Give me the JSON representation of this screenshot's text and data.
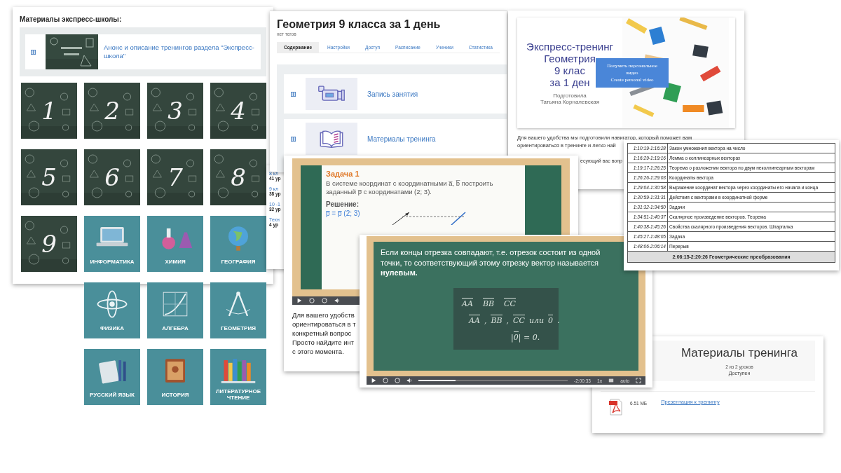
{
  "school_panel": {
    "title": "Материалы экспресс-школы:",
    "announce": {
      "link": "Анонс и описание тренингов раздела \"Экспресс-школа\""
    },
    "number_tiles": [
      "1",
      "2",
      "3",
      "4",
      "5",
      "6",
      "7",
      "8",
      "9"
    ],
    "subject_tiles": [
      "ИНФОРМАТИКА",
      "ХИМИЯ",
      "ГЕОГРАФИЯ",
      "ФИЗИКА",
      "АЛГЕБРА",
      "ГЕОМЕТРИЯ",
      "РУССКИЙ ЯЗЫК",
      "ИСТОРИЯ",
      "ЛИТЕРАТУРНОЕ ЧТЕНИЕ"
    ]
  },
  "course_panel": {
    "title": "Геометрия 9 класса за 1 день",
    "tags": "нет тегов",
    "tabs": [
      {
        "label": "Содержание",
        "selected": true
      },
      {
        "label": "Настройки",
        "selected": false
      },
      {
        "label": "Доступ",
        "selected": false
      },
      {
        "label": "Расписание",
        "selected": false
      },
      {
        "label": "Ученики",
        "selected": false
      },
      {
        "label": "Статистика",
        "selected": false
      }
    ],
    "lessons": [
      {
        "kind": "video",
        "title": "Запись занятия"
      },
      {
        "kind": "book",
        "title": "Материалы тренинга"
      }
    ]
  },
  "hidden_list": [
    {
      "name": "8 кл",
      "count": "41 ур"
    },
    {
      "name": "9 кл",
      "count": "38 ур"
    },
    {
      "name": "10 -1",
      "count": "32 ур"
    },
    {
      "name": "Техн",
      "count": "4 ур"
    }
  ],
  "slide_panel": {
    "slide_lines": [
      "Экспресс-тренинг",
      "Геометрия",
      "9 клас",
      "за 1 ден"
    ],
    "author_lines": [
      "Подготовила",
      "Татьяна Корналевская"
    ],
    "overlay_button": [
      "Получить персональное",
      "видео",
      "Create personal video"
    ],
    "text_lines": [
      "Для вашего удобства мы подготовили навигатор, который поможет вам",
      "ориентироваться в тренинге и легко най",
      "есующий вас вопр"
    ]
  },
  "navigator_table": {
    "rows": [
      {
        "time": "1:10:19-1:16:28",
        "topic": "Закон умножения вектора на число"
      },
      {
        "time": "1:16:29-1:19:16",
        "topic": "Лемма о коллинеарных векторах"
      },
      {
        "time": "1:19:17-1:26:25",
        "topic": "Теорема о разложении вектора по двум неколлинеарным векторам"
      },
      {
        "time": "1:26:26-1:29:03",
        "topic": "Координаты вектора"
      },
      {
        "time": "1:29:04-1:30:58",
        "topic": "Выражение координат вектора через координаты его начала и конца"
      },
      {
        "time": "1:30:59-1:31:31",
        "topic": "Действия с векторами в координатной форме"
      },
      {
        "time": "1:31:32-1:34:50",
        "topic": "Задачи"
      },
      {
        "time": "1:34:51-1:40:37",
        "topic": "Скалярное произведение векторов. Теорема"
      },
      {
        "time": "1:40:38-1:45:26",
        "topic": "Свойства скалярного произведения векторов. Шпаргалка"
      },
      {
        "time": "1:45:27-1:48:05",
        "topic": "Задача"
      },
      {
        "time": "1:48:06-2:06:14",
        "topic": "Перерыв"
      }
    ],
    "footer": "2:06:15-2:20:26 Геометрические преобразования"
  },
  "video_task": {
    "heading": "Задача 1",
    "statement": "В системе координат с координатными a̅, b̅ построить заданный p̅ с координатами (2; 3).",
    "solution_label": "Решение:",
    "solution_lines": [
      "p̅ = p̅ (2; 3)"
    ],
    "text_lines": [
      "Для вашего удобств",
      "ориентироваться в т",
      "конкретный вопрос",
      "Просто найдите инт",
      "с этого момента."
    ]
  },
  "video_vector": {
    "statement": "Если концы отрезка совпадают, т.е. отрезок состоит из одной точки, то соответствующий этому отрезку вектор называется **нулевым.**",
    "formula_rows": [
      [
        {
          "text": "AA",
          "vector": true
        },
        {
          "text": "BB",
          "vector": true
        },
        {
          "text": "CC",
          "vector": true
        }
      ],
      [
        {
          "text": "AA",
          "vector": true
        },
        {
          "text": ",",
          "vector": false
        },
        {
          "text": "BB",
          "vector": true
        },
        {
          "text": ",",
          "vector": false
        },
        {
          "text": "CC",
          "vector": true
        },
        {
          "text": "или",
          "vector": false
        },
        {
          "text": "0",
          "vector": true
        },
        {
          "text": ".",
          "vector": false
        }
      ],
      [
        {
          "text": "|",
          "vector": false
        },
        {
          "text": "0",
          "vector": true
        },
        {
          "text": "| = 0.",
          "vector": false
        }
      ]
    ],
    "player": {
      "level": 0.25,
      "remaining": "-2:00:33",
      "speed": "1x",
      "quality": "auto"
    }
  },
  "materials_panel": {
    "title": "Материалы тренинга",
    "progress": "2 из 2 уроков",
    "status": "Доступен",
    "file": {
      "size": "6.51 МБ",
      "link": "Презентация к тренингу"
    }
  }
}
